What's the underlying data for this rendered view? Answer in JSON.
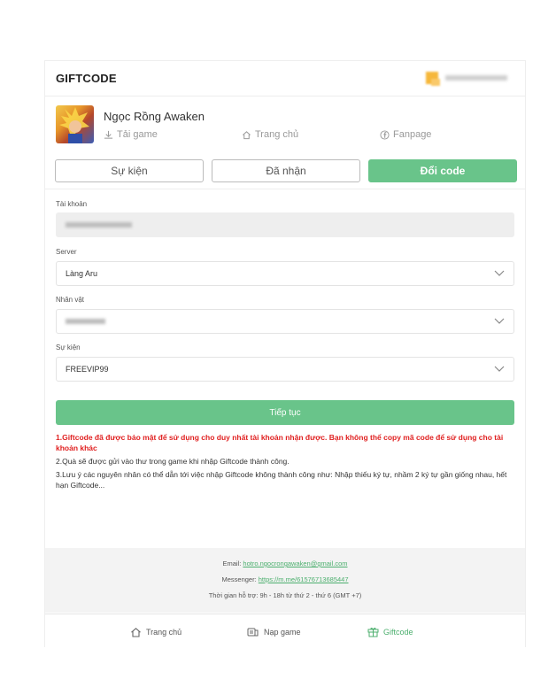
{
  "header": {
    "title": "GIFTCODE"
  },
  "game": {
    "name": "Ngọc Rồng Awaken",
    "download_label": "Tải game",
    "home_label": "Trang chủ",
    "fanpage_label": "Fanpage"
  },
  "tabs": [
    {
      "label": "Sự kiện",
      "active": false
    },
    {
      "label": "Đã nhận",
      "active": false
    },
    {
      "label": "Đổi code",
      "active": true
    }
  ],
  "form": {
    "account_label": "Tài khoản",
    "server_label": "Server",
    "server_value": "Làng Aru",
    "character_label": "Nhân vật",
    "event_label": "Sự kiện",
    "event_value": "FREEVIP99",
    "submit_label": "Tiếp tục"
  },
  "notes": {
    "note1": "1.Giftcode đã được bảo mật để sử dụng cho duy nhất tài khoản nhận được. Bạn không thể copy mã code để sử dụng cho tài khoản khác",
    "note2": "2.Quà sẽ được gửi vào thư trong game khi nhập Giftcode thành công.",
    "note3": "3.Lưu ý các nguyên nhân có thể dẫn tới việc nhập Giftcode không thành công như: Nhập thiếu ký tự, nhầm 2 ký tự gần giống nhau, hết hạn Giftcode..."
  },
  "footer": {
    "email_label": "Email: ",
    "email_value": "hotro.ngocrongawaken@gmail.com",
    "messenger_label": "Messenger: ",
    "messenger_value": "https://m.me/61576713685447",
    "support_hours": "Thời gian hỗ trợ: 9h - 18h từ thứ 2 - thứ 6 (GMT +7)"
  },
  "bottom_nav": {
    "home_label": "Trang chủ",
    "topup_label": "Nạp game",
    "giftcode_label": "Giftcode"
  },
  "colors": {
    "accent": "#69c48a",
    "warning": "#e02020",
    "link": "#4caf6e"
  }
}
